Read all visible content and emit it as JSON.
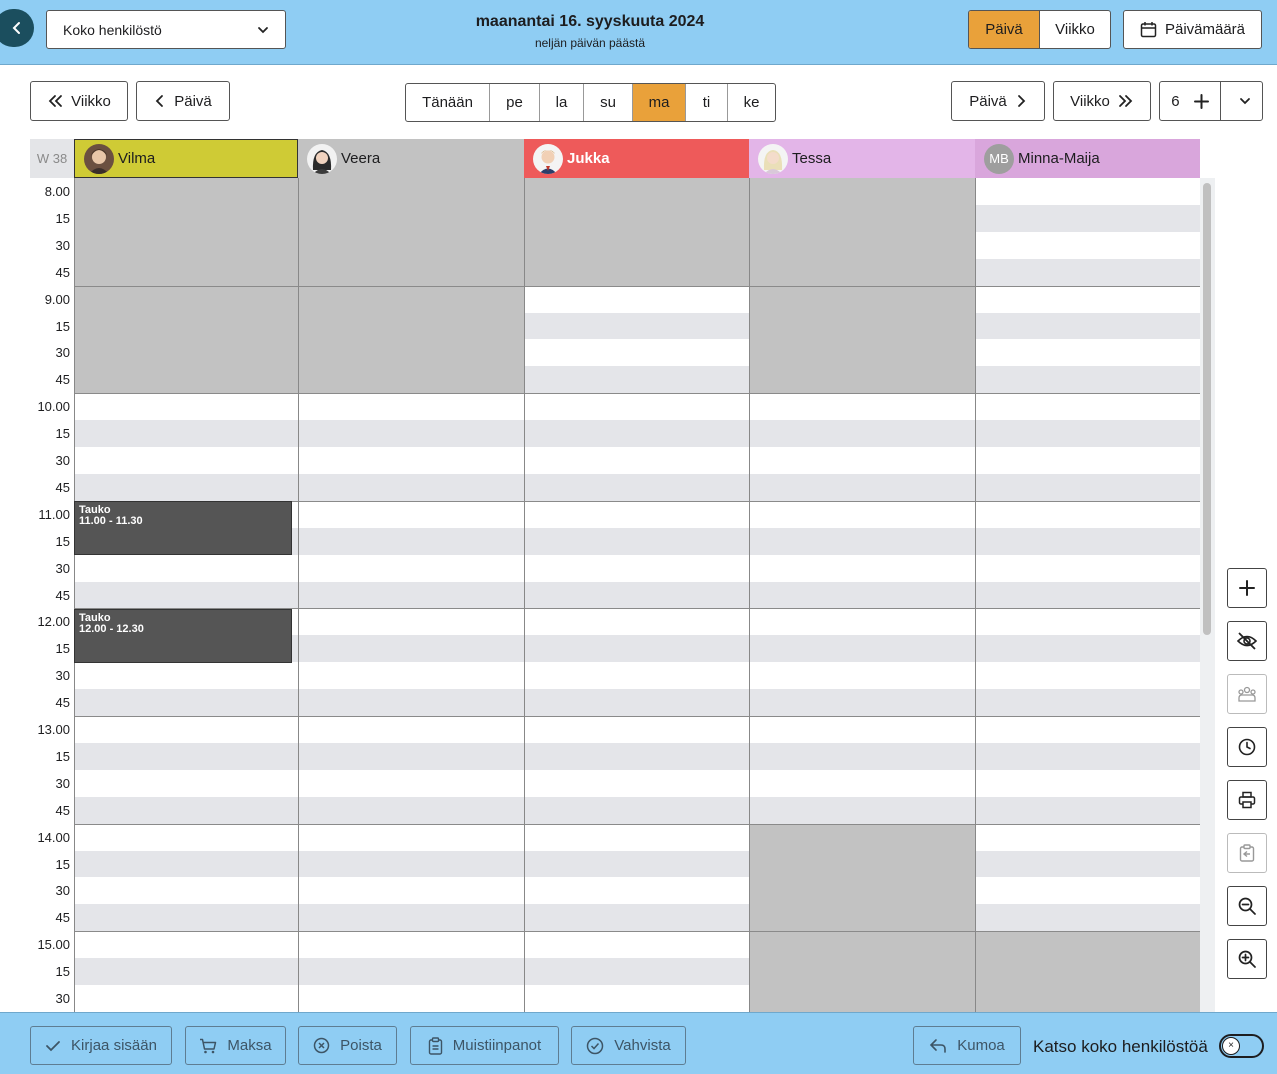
{
  "header": {
    "staff_filter": "Koko henkilöstö",
    "date_title": "maanantai 16. syyskuuta 2024",
    "date_subtitle": "neljän päivän päästä",
    "view_day": "Päivä",
    "view_week": "Viikko",
    "date_picker": "Päivämäärä"
  },
  "nav": {
    "prev_week": "Viikko",
    "prev_day": "Päivä",
    "next_day": "Päivä",
    "next_week": "Viikko",
    "days": [
      "Tänään",
      "pe",
      "la",
      "su",
      "ma",
      "ti",
      "ke"
    ],
    "active_day": "ma",
    "column_count": "6"
  },
  "calendar": {
    "week_label": "W 38",
    "staff": [
      {
        "name": "Vilma",
        "color": "#cfcb35",
        "avatar": "photo-avatar"
      },
      {
        "name": "Veera",
        "color": "#c2c2c2",
        "avatar": "photo-avatar"
      },
      {
        "name": "Jukka",
        "color": "#ee5a5a",
        "avatar": "photo-avatar"
      },
      {
        "name": "Tessa",
        "color": "#e3b5e8",
        "avatar": "photo-avatar"
      },
      {
        "name": "Minna-Maija",
        "color": "#d9a6dc",
        "initials": "MB"
      }
    ],
    "times": [
      "8.00",
      "15",
      "30",
      "45",
      "9.00",
      "15",
      "30",
      "45",
      "10.00",
      "15",
      "30",
      "45",
      "11.00",
      "15",
      "30",
      "45",
      "12.00",
      "15",
      "30",
      "45",
      "13.00",
      "15",
      "30",
      "45",
      "14.00",
      "15",
      "30",
      "45",
      "15.00",
      "15",
      "30"
    ],
    "events": [
      {
        "title": "Tauko",
        "time": "11.00 - 11.30"
      },
      {
        "title": "Tauko",
        "time": "12.00 - 12.30"
      }
    ]
  },
  "tools": [
    "plus-icon",
    "eye-off-icon",
    "group-icon",
    "clock-icon",
    "printer-icon",
    "clipboard-icon",
    "zoom-out-icon",
    "zoom-in-icon"
  ],
  "bottom": {
    "check_in": "Kirjaa sisään",
    "pay": "Maksa",
    "delete": "Poista",
    "notes": "Muistiinpanot",
    "confirm": "Vahvista",
    "undo": "Kumoa",
    "toggle_label": "Katso koko henkilöstöä"
  }
}
